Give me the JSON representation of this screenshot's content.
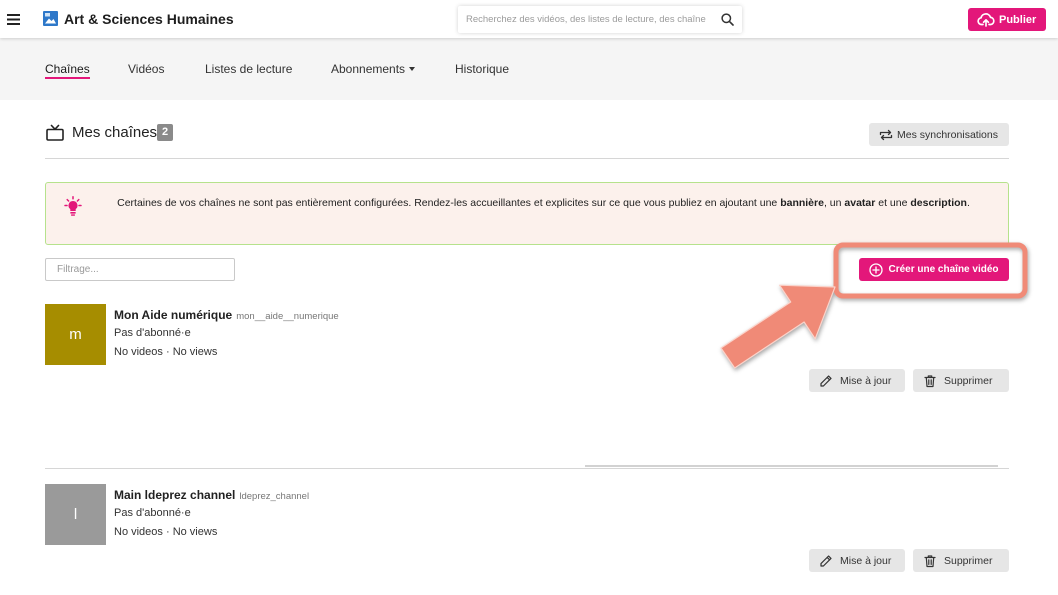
{
  "theme": {
    "accent": "#e3177a",
    "annotation": "#f08a77"
  },
  "header": {
    "menu_icon": "hamburger-icon",
    "logo_icon": "instance-logo-icon",
    "app_title": "Art & Sciences Humaines",
    "search_placeholder": "Recherchez des vidéos, des listes de lecture, des chaîne",
    "search_icon": "search-icon",
    "publish_label": "Publier",
    "publish_icon": "upload-cloud-icon"
  },
  "nav": {
    "tabs": [
      {
        "label": "Chaînes",
        "active": true
      },
      {
        "label": "Vidéos",
        "active": false
      },
      {
        "label": "Listes de lecture",
        "active": false
      },
      {
        "label": "Abonnements",
        "active": false,
        "has_dropdown": true
      },
      {
        "label": "Historique",
        "active": false
      }
    ]
  },
  "main": {
    "title_icon": "tv-icon",
    "title": "Mes chaînes",
    "channel_count": 2,
    "sync_button": {
      "label": "Mes synchronisations",
      "icon": "sync-icon"
    },
    "alert": {
      "icon": "lightbulb-icon",
      "text_before": "Certaines de vos chaînes ne sont pas entièrement configurées. Rendez-les accueillantes et explicites sur ce que vous publiez en ajoutant une ",
      "bold_1": "bannière",
      "text_mid_1": ", un ",
      "bold_2": "avatar",
      "text_mid_2": " et une ",
      "bold_3": "description",
      "text_after": "."
    },
    "filter_placeholder": "Filtrage...",
    "create_button": {
      "label": "Créer une chaîne vidéo",
      "icon": "plus-circle-icon"
    },
    "channels": [
      {
        "initial": "m",
        "avatar_color": "#a68d00",
        "name": "Mon Aide numérique",
        "handle": "mon__aide__numerique",
        "subscribers": "Pas d'abonné·e",
        "stats": "No videos · No views",
        "update_label": "Mise à jour",
        "update_icon": "pencil-icon",
        "delete_label": "Supprimer",
        "delete_icon": "trash-icon"
      },
      {
        "initial": "l",
        "avatar_color": "#9a9a9a",
        "name": "Main ldeprez channel",
        "handle": "ldeprez_channel",
        "subscribers": "Pas d'abonné·e",
        "stats": "No videos · No views",
        "update_label": "Mise à jour",
        "update_icon": "pencil-icon",
        "delete_label": "Supprimer",
        "delete_icon": "trash-icon"
      }
    ]
  }
}
